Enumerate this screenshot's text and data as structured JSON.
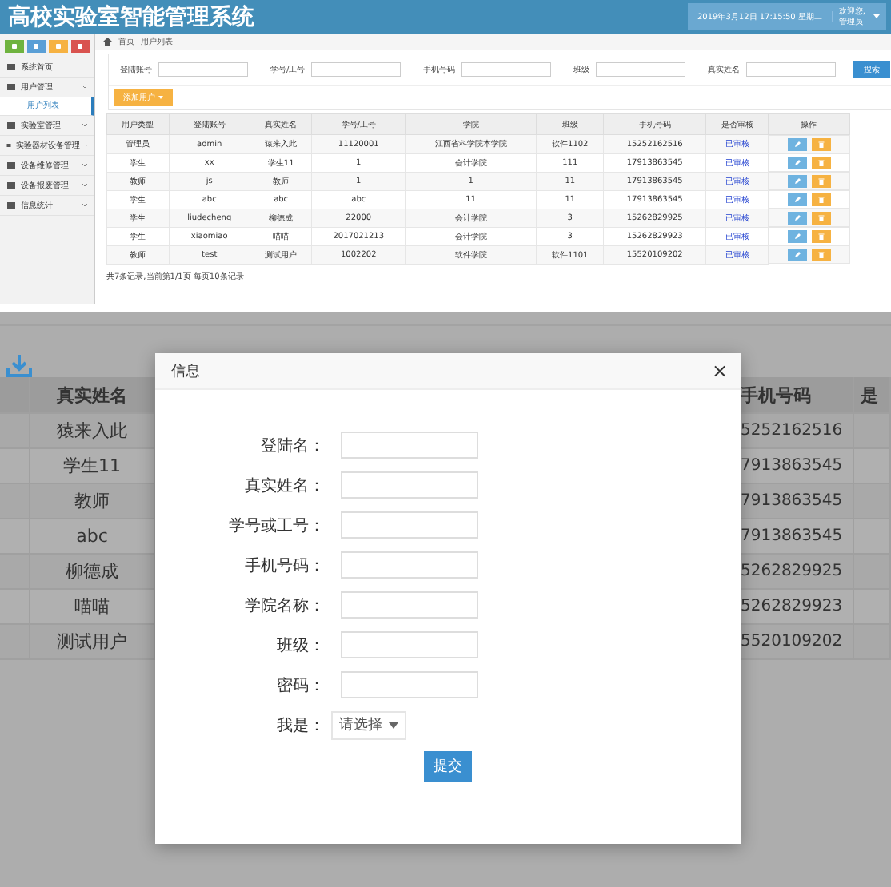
{
  "app": {
    "title": "高校实验室智能管理系统",
    "datetime": "2019年3月12日 17:15:50 星期二",
    "user": "欢迎您,",
    "user_name": "管理员"
  },
  "sidebar": {
    "tool_buttons": [
      {
        "color": "#6fb33f"
      },
      {
        "color": "#5a9fd6"
      },
      {
        "color": "#f6b242"
      },
      {
        "color": "#d9534f"
      }
    ],
    "items": [
      {
        "label": "系统首页"
      },
      {
        "label": "用户管理",
        "children": [
          {
            "label": "用户列表",
            "selected": true
          }
        ]
      },
      {
        "label": "实验室管理"
      },
      {
        "label": "实验器材设备管理"
      },
      {
        "label": "设备维修管理"
      },
      {
        "label": "设备报废管理"
      },
      {
        "label": "信息统计"
      }
    ]
  },
  "breadcrumb": [
    "首页",
    "用户列表"
  ],
  "search": {
    "fields": [
      "登陆账号",
      "学号/工号",
      "手机号码",
      "班级",
      "真实姓名"
    ],
    "button": "搜索"
  },
  "add_button": "添加用户",
  "table": {
    "columns": [
      "用户类型",
      "登陆账号",
      "真实姓名",
      "学号/工号",
      "学院",
      "班级",
      "手机号码",
      "是否审核",
      "操作"
    ],
    "rows": [
      {
        "cells": [
          "管理员",
          "admin",
          "猿来入此",
          "11120001",
          "江西省科学院本学院",
          "软件1102",
          "15252162516"
        ],
        "status": "已审核"
      },
      {
        "cells": [
          "学生",
          "xx",
          "学生11",
          "1",
          "会计学院",
          "111",
          "17913863545"
        ],
        "status": "已审核"
      },
      {
        "cells": [
          "教师",
          "js",
          "教师",
          "1",
          "1",
          "11",
          "17913863545"
        ],
        "status": "已审核"
      },
      {
        "cells": [
          "学生",
          "abc",
          "abc",
          "abc",
          "11",
          "11",
          "17913863545"
        ],
        "status": "已审核"
      },
      {
        "cells": [
          "学生",
          "liudecheng",
          "柳德成",
          "22000",
          "会计学院",
          "3",
          "15262829925"
        ],
        "status": "已审核"
      },
      {
        "cells": [
          "学生",
          "xiaomiao",
          "喵喵",
          "2017021213",
          "会计学院",
          "3",
          "15262829923"
        ],
        "status": "已审核"
      },
      {
        "cells": [
          "教师",
          "test",
          "测试用户",
          "1002202",
          "软件学院",
          "软件1101",
          "15520109202"
        ],
        "status": "已审核"
      }
    ]
  },
  "footer": "共7条记录,当前第1/1页 每页10条记录",
  "background_table": {
    "columns": [
      "真实姓名",
      "手机号码",
      "是"
    ],
    "rows": [
      {
        "name": "猿来入此",
        "phone": "5252162516"
      },
      {
        "name": "学生11",
        "phone": "7913863545"
      },
      {
        "name": "教师",
        "phone": "7913863545"
      },
      {
        "name": "abc",
        "phone": "7913863545"
      },
      {
        "name": "柳德成",
        "phone": "5262829925"
      },
      {
        "name": "喵喵",
        "phone": "5262829923"
      },
      {
        "name": "测试用户",
        "phone": "5520109202"
      }
    ]
  },
  "dialog": {
    "title": "信息",
    "close": "×",
    "fields": [
      {
        "label": "登陆名：",
        "kind": "text"
      },
      {
        "label": "真实姓名：",
        "kind": "text"
      },
      {
        "label": "学号或工号：",
        "kind": "text"
      },
      {
        "label": "手机号码：",
        "kind": "text"
      },
      {
        "label": "学院名称：",
        "kind": "text"
      },
      {
        "label": "班级：",
        "kind": "text"
      },
      {
        "label": "密码：",
        "kind": "text"
      },
      {
        "label": "我是：",
        "kind": "select",
        "value": "请选择"
      }
    ],
    "submit": "提交"
  }
}
